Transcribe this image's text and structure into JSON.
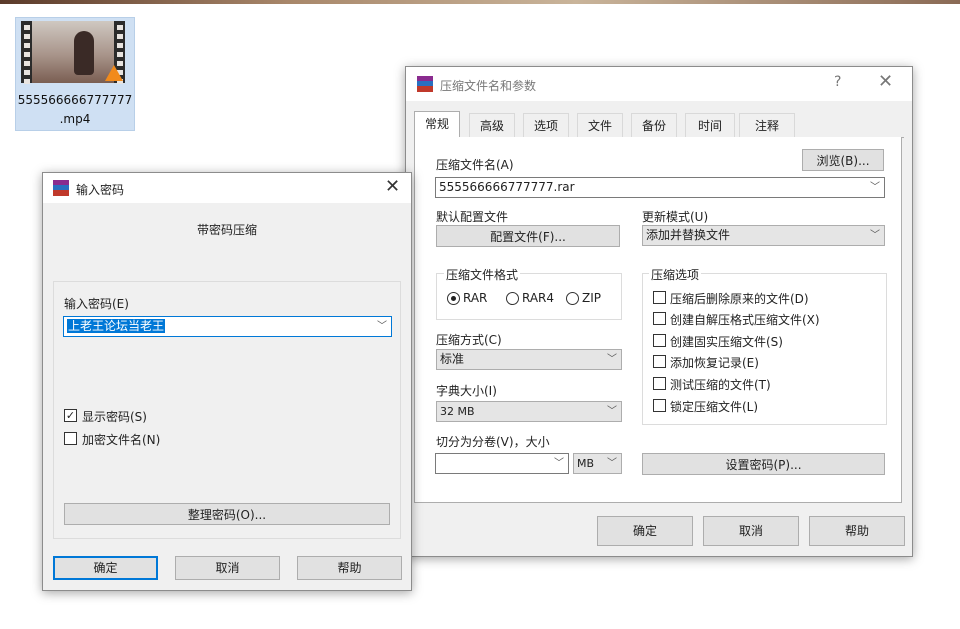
{
  "desktop": {
    "file_name": "555566666777777\n.mp4",
    "file_name_line1": "555566666777777",
    "file_name_line2": ".mp4"
  },
  "password_dialog": {
    "title": "输入密码",
    "subtitle": "带密码压缩",
    "password_label": "输入密码(E)",
    "password_value": "上老王论坛当老王",
    "show_password_label": "显示密码(S)",
    "show_password_checked": true,
    "encrypt_names_label": "加密文件名(N)",
    "encrypt_names_checked": false,
    "manage_button": "整理密码(O)...",
    "ok_button": "确定",
    "cancel_button": "取消",
    "help_button": "帮助"
  },
  "archive_dialog": {
    "title": "压缩文件名和参数",
    "help_glyph": "?",
    "tabs": [
      "常规",
      "高级",
      "选项",
      "文件",
      "备份",
      "时间",
      "注释"
    ],
    "active_tab": 0,
    "archive_name_label": "压缩文件名(A)",
    "browse_button": "浏览(B)...",
    "archive_name_value": "555566666777777.rar",
    "profile_label": "默认配置文件",
    "profile_button": "配置文件(F)...",
    "update_mode_label": "更新模式(U)",
    "update_mode_value": "添加并替换文件",
    "format_group_label": "压缩文件格式",
    "formats": [
      "RAR",
      "RAR4",
      "ZIP"
    ],
    "selected_format": "RAR",
    "method_label": "压缩方式(C)",
    "method_value": "标准",
    "dict_label": "字典大小(I)",
    "dict_value": "32 MB",
    "split_label": "切分为分卷(V)，大小",
    "split_value": "",
    "split_unit": "MB",
    "options_group_label": "压缩选项",
    "options": [
      {
        "label": "压缩后删除原来的文件(D)",
        "checked": false
      },
      {
        "label": "创建自解压格式压缩文件(X)",
        "checked": false
      },
      {
        "label": "创建固实压缩文件(S)",
        "checked": false
      },
      {
        "label": "添加恢复记录(E)",
        "checked": false
      },
      {
        "label": "测试压缩的文件(T)",
        "checked": false
      },
      {
        "label": "锁定压缩文件(L)",
        "checked": false
      }
    ],
    "set_password_button": "设置密码(P)...",
    "ok_button": "确定",
    "cancel_button": "取消",
    "help_button": "帮助"
  },
  "colors": {
    "accent": "#0078d7",
    "selection": "#0078d7",
    "dialog_bg": "#f0f0f0"
  }
}
